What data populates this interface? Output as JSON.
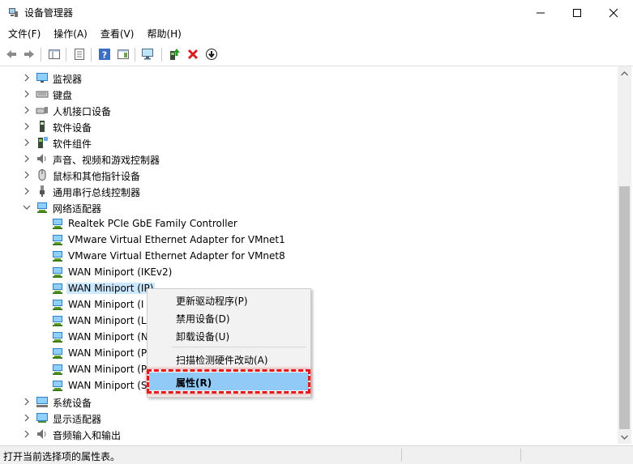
{
  "window": {
    "title": "设备管理器",
    "minimize_icon": "minimize-icon",
    "maximize_icon": "maximize-icon",
    "close_icon": "close-icon"
  },
  "menubar": {
    "items": [
      {
        "label": "文件(F)"
      },
      {
        "label": "操作(A)"
      },
      {
        "label": "查看(V)"
      },
      {
        "label": "帮助(H)"
      }
    ]
  },
  "toolbar": {
    "icons": [
      "back-arrow-icon",
      "forward-arrow-icon",
      "show-hide-console-tree-icon",
      "properties-icon",
      "help-icon",
      "action-pane-icon",
      "scan-monitor-icon",
      "update-driver-icon",
      "uninstall-x-icon",
      "disable-down-arrow-icon"
    ]
  },
  "tree": {
    "rows": [
      {
        "label": "监视器",
        "icon": "monitor-icon",
        "expanded": false,
        "level": 0
      },
      {
        "label": "键盘",
        "icon": "keyboard-icon",
        "expanded": false,
        "level": 0
      },
      {
        "label": "人机接口设备",
        "icon": "hid-icon",
        "expanded": false,
        "level": 0
      },
      {
        "label": "软件设备",
        "icon": "software-device-icon",
        "expanded": false,
        "level": 0
      },
      {
        "label": "软件组件",
        "icon": "software-component-icon",
        "expanded": false,
        "level": 0
      },
      {
        "label": "声音、视频和游戏控制器",
        "icon": "speaker-icon",
        "expanded": false,
        "level": 0
      },
      {
        "label": "鼠标和其他指针设备",
        "icon": "mouse-icon",
        "expanded": false,
        "level": 0
      },
      {
        "label": "通用串行总线控制器",
        "icon": "usb-icon",
        "expanded": false,
        "level": 0
      },
      {
        "label": "网络适配器",
        "icon": "network-adapter-icon",
        "expanded": true,
        "level": 0
      },
      {
        "label": "Realtek PCIe GbE Family Controller",
        "icon": "network-adapter-icon",
        "level": 1
      },
      {
        "label": "VMware Virtual Ethernet Adapter for VMnet1",
        "icon": "network-adapter-icon",
        "level": 1
      },
      {
        "label": "VMware Virtual Ethernet Adapter for VMnet8",
        "icon": "network-adapter-icon",
        "level": 1
      },
      {
        "label": "WAN Miniport (IKEv2)",
        "icon": "network-adapter-icon",
        "level": 1
      },
      {
        "label": "WAN Miniport (IP)",
        "icon": "network-adapter-icon",
        "level": 1,
        "selected": true
      },
      {
        "label": "WAN Miniport (I",
        "icon": "network-adapter-icon",
        "level": 1
      },
      {
        "label": "WAN Miniport (L",
        "icon": "network-adapter-icon",
        "level": 1
      },
      {
        "label": "WAN Miniport (N",
        "icon": "network-adapter-icon",
        "level": 1
      },
      {
        "label": "WAN Miniport (P",
        "icon": "network-adapter-icon",
        "level": 1
      },
      {
        "label": "WAN Miniport (P",
        "icon": "network-adapter-icon",
        "level": 1
      },
      {
        "label": "WAN Miniport (S",
        "icon": "network-adapter-icon",
        "level": 1
      },
      {
        "label": "系统设备",
        "icon": "system-device-icon",
        "expanded": false,
        "level": 0
      },
      {
        "label": "显示适配器",
        "icon": "display-adapter-icon",
        "expanded": false,
        "level": 0
      },
      {
        "label": "音频输入和输出",
        "icon": "audio-io-icon",
        "expanded": false,
        "level": 0
      }
    ]
  },
  "context_menu": {
    "items": [
      {
        "label": "更新驱动程序(P)"
      },
      {
        "label": "禁用设备(D)"
      },
      {
        "label": "卸载设备(U)"
      },
      {
        "label": "扫描检测硬件改动(A)"
      },
      {
        "label": "属性(R)",
        "highlighted": true
      }
    ]
  },
  "statusbar": {
    "text": "打开当前选择项的属性表。"
  },
  "colors": {
    "selection": "#cce8ff",
    "menu_highlight": "#91c9f7",
    "annotation": "#e21c1c"
  }
}
